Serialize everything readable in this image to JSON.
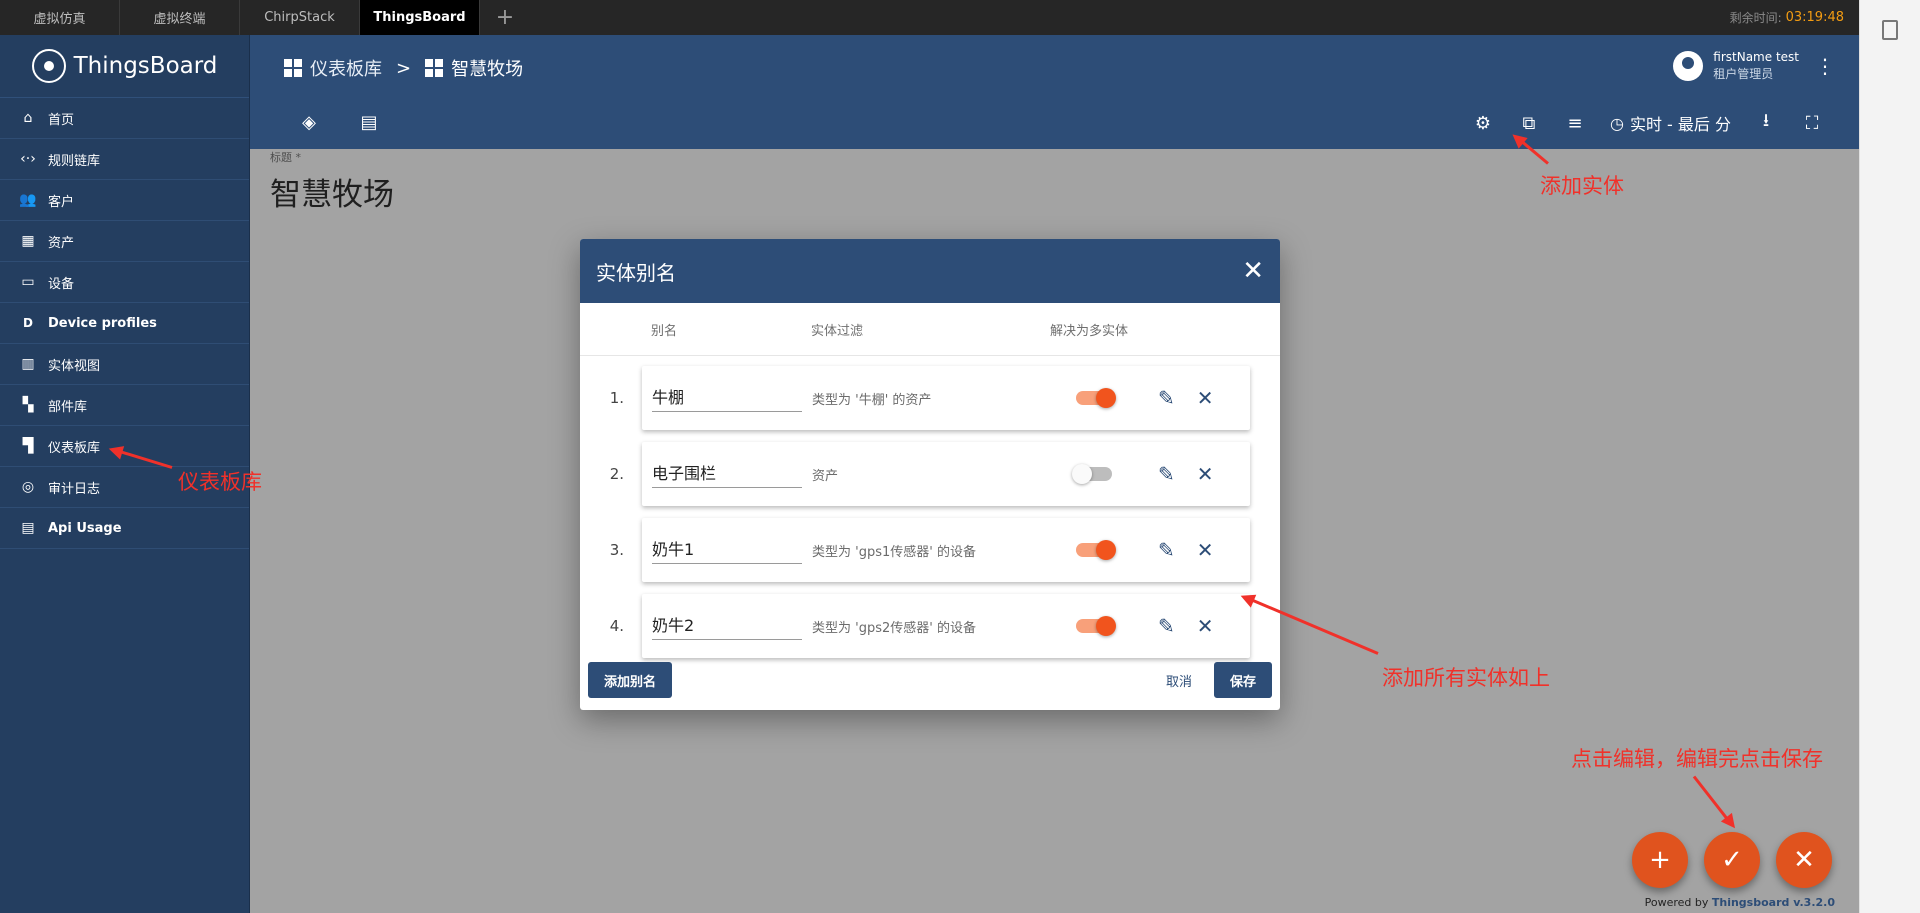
{
  "tabs": [
    {
      "label": "虚拟仿真",
      "active": false
    },
    {
      "label": "虚拟终端",
      "active": false
    },
    {
      "label": "ChirpStack",
      "active": false
    },
    {
      "label": "ThingsBoard",
      "active": true
    }
  ],
  "tab_add": "+",
  "timer": {
    "label": "剩余时间:",
    "value": "03:19:48"
  },
  "logo": {
    "text": "ThingsBoard"
  },
  "sidebar": {
    "items": [
      {
        "label": "首页",
        "icon": "home-icon",
        "glyph": "⌂"
      },
      {
        "label": "规则链库",
        "icon": "rule-chain-icon",
        "glyph": "‹·›"
      },
      {
        "label": "客户",
        "icon": "customers-icon",
        "glyph": "👥"
      },
      {
        "label": "资产",
        "icon": "asset-icon",
        "glyph": "▦"
      },
      {
        "label": "设备",
        "icon": "device-icon",
        "glyph": "▭"
      },
      {
        "label": "Device profiles",
        "icon": "device-profile-icon",
        "glyph": "D"
      },
      {
        "label": "实体视图",
        "icon": "entity-view-icon",
        "glyph": "▥"
      },
      {
        "label": "部件库",
        "icon": "widgets-icon",
        "glyph": "▚"
      },
      {
        "label": "仪表板库",
        "icon": "dashboard-icon",
        "glyph": "▜"
      },
      {
        "label": "审计日志",
        "icon": "audit-log-icon",
        "glyph": "◎"
      },
      {
        "label": "Api Usage",
        "icon": "api-usage-icon",
        "glyph": "▤"
      }
    ]
  },
  "header": {
    "breadcrumb": [
      {
        "label": "仪表板库"
      },
      {
        "label": "智慧牧场"
      }
    ],
    "breadcrumb_sep": ">",
    "user": {
      "name": "firstName test",
      "role": "租户管理员"
    },
    "time_window": "实时 - 最后 分"
  },
  "main": {
    "title_caption": "标题 *",
    "title": "智慧牧场",
    "powered": {
      "prefix": "Powered by ",
      "brand": "Thingsboard v.3.2.0"
    }
  },
  "dialog": {
    "title": "实体别名",
    "columns": {
      "alias": "别名",
      "filter": "实体过滤",
      "multi": "解决为多实体"
    },
    "rows": [
      {
        "num": "1.",
        "alias": "牛棚",
        "filter": "类型为 '牛棚' 的资产",
        "multi": true
      },
      {
        "num": "2.",
        "alias": "电子围栏",
        "filter": "资产",
        "multi": false
      },
      {
        "num": "3.",
        "alias": "奶牛1",
        "filter": "类型为 'gps1传感器' 的设备",
        "multi": true
      },
      {
        "num": "4.",
        "alias": "奶牛2",
        "filter": "类型为 'gps2传感器' 的设备",
        "multi": true
      }
    ],
    "add_label": "添加别名",
    "cancel_label": "取消",
    "save_label": "保存"
  },
  "annotations": {
    "add_entity": "添加实体",
    "dashboard_lib": "仪表板库",
    "all_added": "添加所有实体如上",
    "edit_save": "点击编辑，编辑完点击保存"
  },
  "colors": {
    "sidebar_bg": "#243e60",
    "header_bg": "#2d4d77",
    "accent": "#f1541d",
    "fab": "#e0531e",
    "annotation": "#f0312a"
  }
}
